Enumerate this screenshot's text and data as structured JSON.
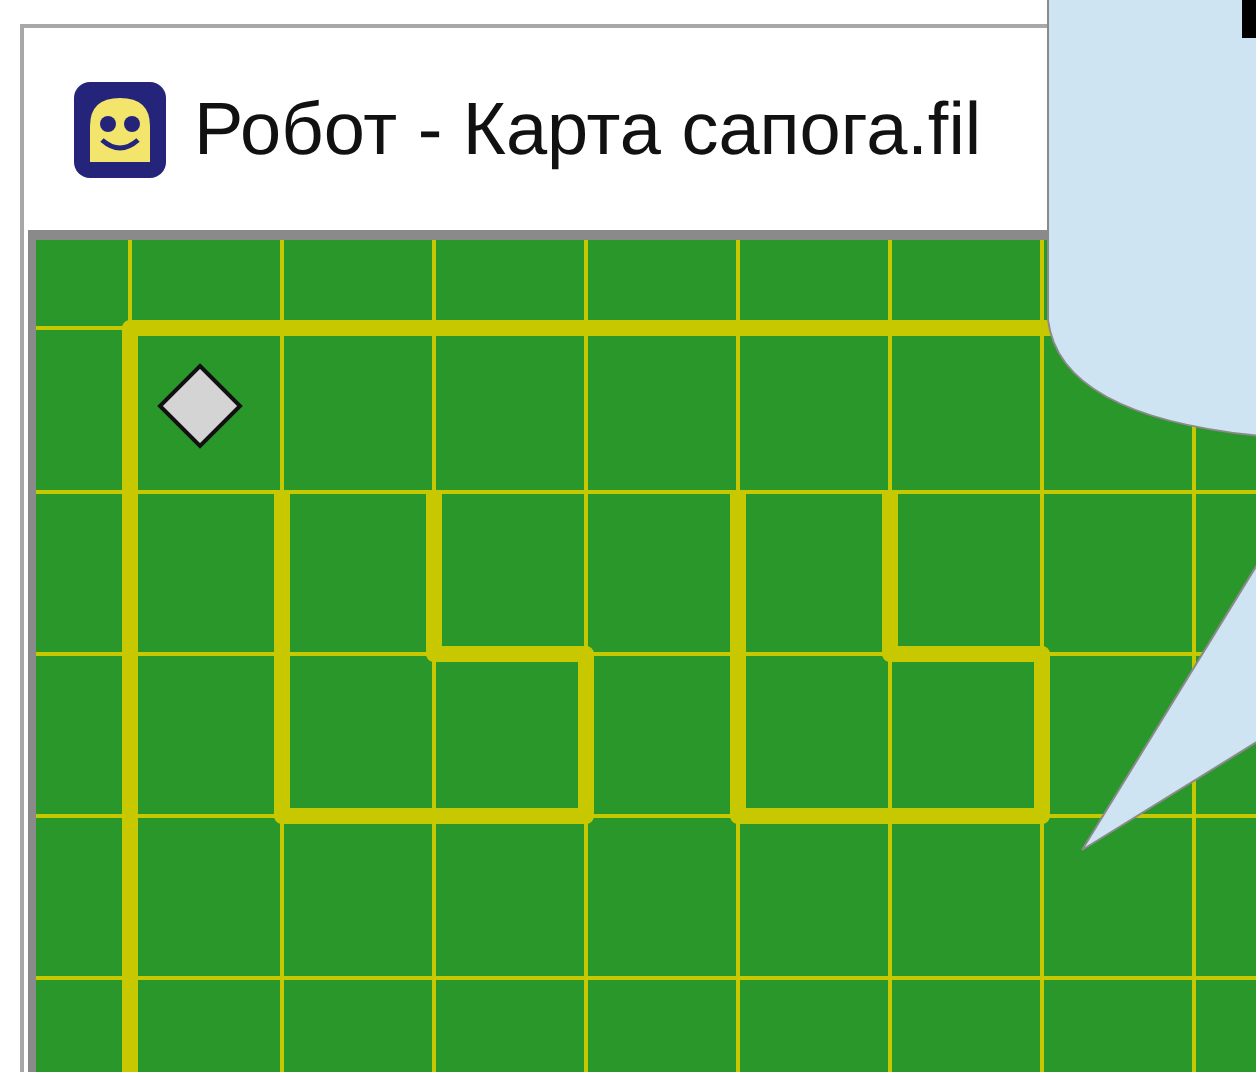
{
  "window": {
    "title": "Робот - Карта сапога.fil"
  }
}
